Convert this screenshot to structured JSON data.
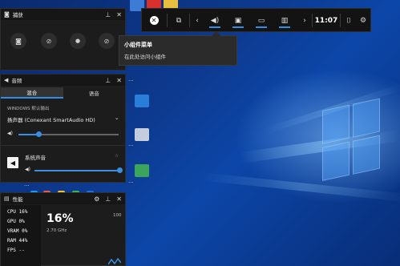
{
  "desktop": {
    "icons": [
      {
        "name": "wps-icon",
        "label": "",
        "color": "#d8302c"
      },
      {
        "name": "desktop-app-icon-2",
        "label": "",
        "color": "#3c7bd6"
      },
      {
        "name": "desktop-app-icon-3",
        "label": "",
        "color": "#e8c040"
      }
    ],
    "labels": {
      "l1": "…",
      "l2": "…",
      "l3": "…",
      "l4": "…"
    }
  },
  "capture": {
    "title": "捕获",
    "buttons": [
      "camera-icon",
      "no-record-icon",
      "record-dot-icon",
      "mic-off-icon"
    ]
  },
  "audio": {
    "title": "音频",
    "tabs": [
      "混合",
      "语音"
    ],
    "device_label": "WINDOWS 默认输出",
    "device_name": "扬声器 (Conexant SmartAudio HD)",
    "master_volume": 0.2,
    "app_name": "系统声音",
    "app_volume": 1.0
  },
  "performance": {
    "title": "性能",
    "rows": [
      {
        "label": "CPU",
        "value": "16%"
      },
      {
        "label": "GPU",
        "value": "0%"
      },
      {
        "label": "VRAM",
        "value": "0%"
      },
      {
        "label": "RAM",
        "value": "44%"
      },
      {
        "label": "FPS",
        "value": "--"
      }
    ],
    "big_value": "16%",
    "sub_value": "2.70 GHz",
    "scale_max": "100"
  },
  "topbar": {
    "time": "11:07"
  },
  "tooltip": {
    "title": "小组件菜单",
    "description": "在此处访问小组件"
  },
  "colors": {
    "accent": "#2f8de4",
    "panel_bg": "#1c1c1c",
    "panel_header": "#161616"
  }
}
